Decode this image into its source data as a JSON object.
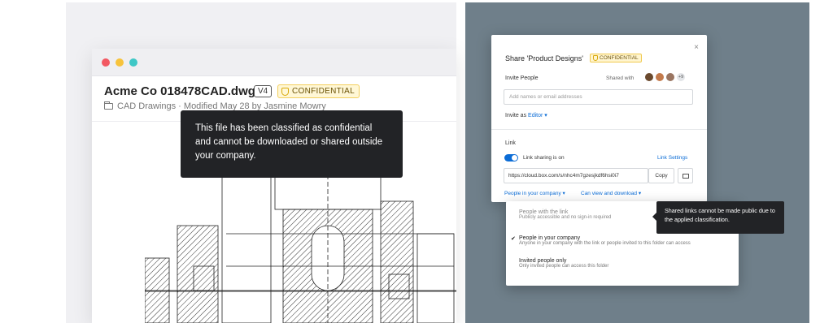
{
  "colors": {
    "accent": "#0b6cd6",
    "confidential_bg": "#fff7d6",
    "tooltip_bg": "#222326",
    "right_backdrop": "#6f7f8a"
  },
  "file": {
    "title": "Acme Co 018478CAD.dwg",
    "version": "V4",
    "classification": "CONFIDENTIAL",
    "subtitle": "CAD Drawings · Modified May 28 by Jasmine Mowry",
    "folder_icon": "folder-icon"
  },
  "tooltip_left": {
    "text": "This file has been classified as confidential and cannot be downloaded or shared outside your company."
  },
  "share_modal": {
    "title": "Share 'Product Designs'",
    "classification": "CONFIDENTIAL",
    "close": "×",
    "invite_label": "Invite People",
    "shared_with_label": "Shared with",
    "more_count": "+9",
    "invite_placeholder": "Add names or email addresses",
    "invite_as_prefix": "Invite as",
    "invite_as_role": "Editor ▾",
    "link_label": "Link",
    "link_sharing_text": "Link sharing is on",
    "link_settings": "Link Settings",
    "url": "https://cloud.box.com/s/nhc4m7gzesjkdf6hsi0i7",
    "copy_label": "Copy",
    "people_scope": "People in your company ▾",
    "permission": "Can view and download ▾"
  },
  "dropdown": {
    "items": [
      {
        "title": "People with the link",
        "desc": "Publicly accessible and no sign-in required",
        "checked": false,
        "disabled": true
      },
      {
        "title": "People in your company",
        "desc": "Anyone in your company with the link or people invited to this folder can access",
        "checked": true,
        "disabled": false
      },
      {
        "title": "Invited people only",
        "desc": "Only invited people can access this folder",
        "checked": false,
        "disabled": false
      }
    ]
  },
  "tooltip_right": {
    "text": "Shared links cannot be made public due to the applied classification."
  }
}
